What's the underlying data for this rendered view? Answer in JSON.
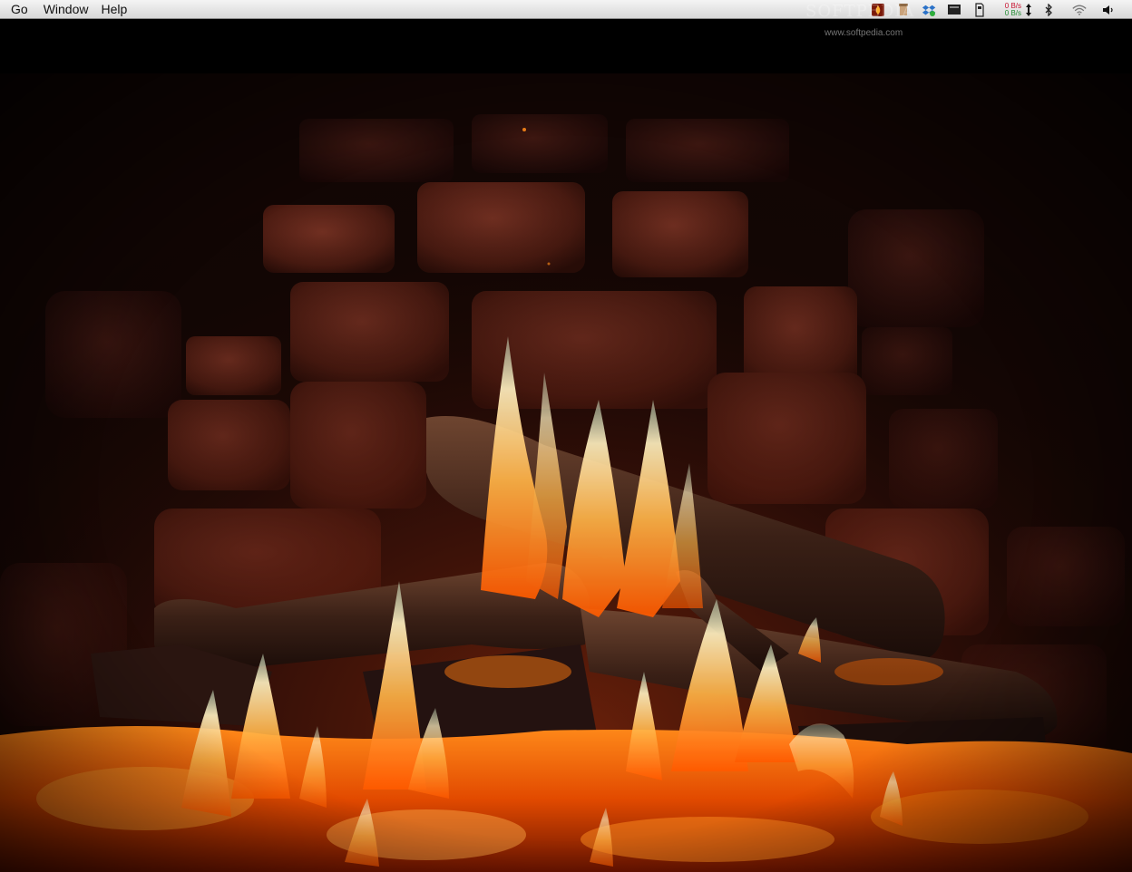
{
  "menubar": {
    "items": [
      "Go",
      "Window",
      "Help"
    ],
    "status_icons": [
      "fireplace-app-icon",
      "scroll-icon",
      "dropbox-icon",
      "display-icon",
      "sd-card-icon",
      "bluetooth-icon",
      "wifi-icon",
      "volume-icon"
    ],
    "net_up": "0 B/s",
    "net_down": "0 B/s"
  },
  "watermark": {
    "logo": "SOFTPEDIA",
    "url": "www.softpedia.com"
  },
  "scene": {
    "description_icon": "fireplace-scene",
    "colors": {
      "background": "#000000",
      "stone": "#5a2418",
      "mortar": "#120604",
      "ember": "#ff6a00",
      "flame": "#ffd27a"
    }
  }
}
